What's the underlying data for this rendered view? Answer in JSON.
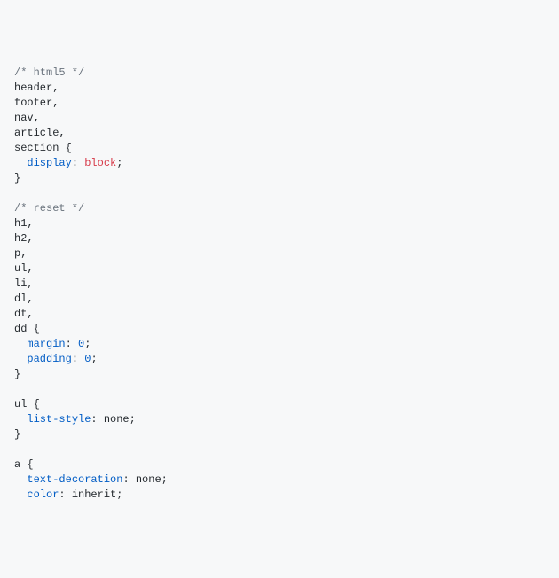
{
  "comment1": "/* html5 */",
  "sel1a": "header,",
  "sel1b": "footer,",
  "sel1c": "nav,",
  "sel1d": "article,",
  "sel1e": "section {",
  "prop_display": "display",
  "colon_sp": ": ",
  "val_block": "block",
  "semi": ";",
  "close": "}",
  "blank": "",
  "comment2": "/* reset */",
  "sel2a": "h1,",
  "sel2b": "h2,",
  "sel2c": "p,",
  "sel2d": "ul,",
  "sel2e": "li,",
  "sel2f": "dl,",
  "sel2g": "dt,",
  "sel2h": "dd {",
  "prop_margin": "margin",
  "prop_padding": "padding",
  "zero": "0",
  "sel3": "ul {",
  "prop_liststyle": "list-style",
  "val_none": "none",
  "sel4": "a {",
  "prop_textdeco": "text-decoration",
  "prop_color": "color",
  "val_inherit": "inherit",
  "indent": "  ",
  "chart_data": {
    "type": "table",
    "title": "CSS source snippet",
    "rules": [
      {
        "selectors": [
          "header",
          "footer",
          "nav",
          "article",
          "section"
        ],
        "declarations": {
          "display": "block"
        }
      },
      {
        "selectors": [
          "h1",
          "h2",
          "p",
          "ul",
          "li",
          "dl",
          "dt",
          "dd"
        ],
        "declarations": {
          "margin": "0",
          "padding": "0"
        }
      },
      {
        "selectors": [
          "ul"
        ],
        "declarations": {
          "list-style": "none"
        }
      },
      {
        "selectors": [
          "a"
        ],
        "declarations": {
          "text-decoration": "none",
          "color": "inherit"
        }
      }
    ]
  }
}
